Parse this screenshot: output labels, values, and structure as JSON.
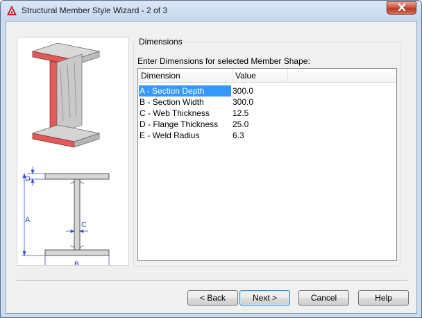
{
  "window": {
    "title": "Structural Member Style Wizard - 2 of 3",
    "app_icon": "autocad-logo-icon",
    "close_icon": "close-icon"
  },
  "image_panel": {
    "diagram_labels": {
      "d": "D",
      "a": "A",
      "c": "C",
      "b": "B"
    }
  },
  "dimensions_group": {
    "title": "Dimensions",
    "prompt": "Enter Dimensions for selected Member Shape:",
    "columns": [
      "Dimension",
      "Value"
    ],
    "rows": [
      {
        "dimension": "A - Section Depth",
        "value": "300.0",
        "selected": true
      },
      {
        "dimension": "B - Section Width",
        "value": "300.0",
        "selected": false
      },
      {
        "dimension": "C - Web Thickness",
        "value": "12.5",
        "selected": false
      },
      {
        "dimension": "D - Flange Thickness",
        "value": "25.0",
        "selected": false
      },
      {
        "dimension": "E - Weld Radius",
        "value": "6.3",
        "selected": false
      }
    ]
  },
  "buttons": {
    "back": "< Back",
    "next": "Next >",
    "cancel": "Cancel",
    "help": "Help"
  },
  "colors": {
    "selection": "#3399ff",
    "flange_highlight": "#e05a5a",
    "dimension_lines": "#3a4fd0"
  }
}
